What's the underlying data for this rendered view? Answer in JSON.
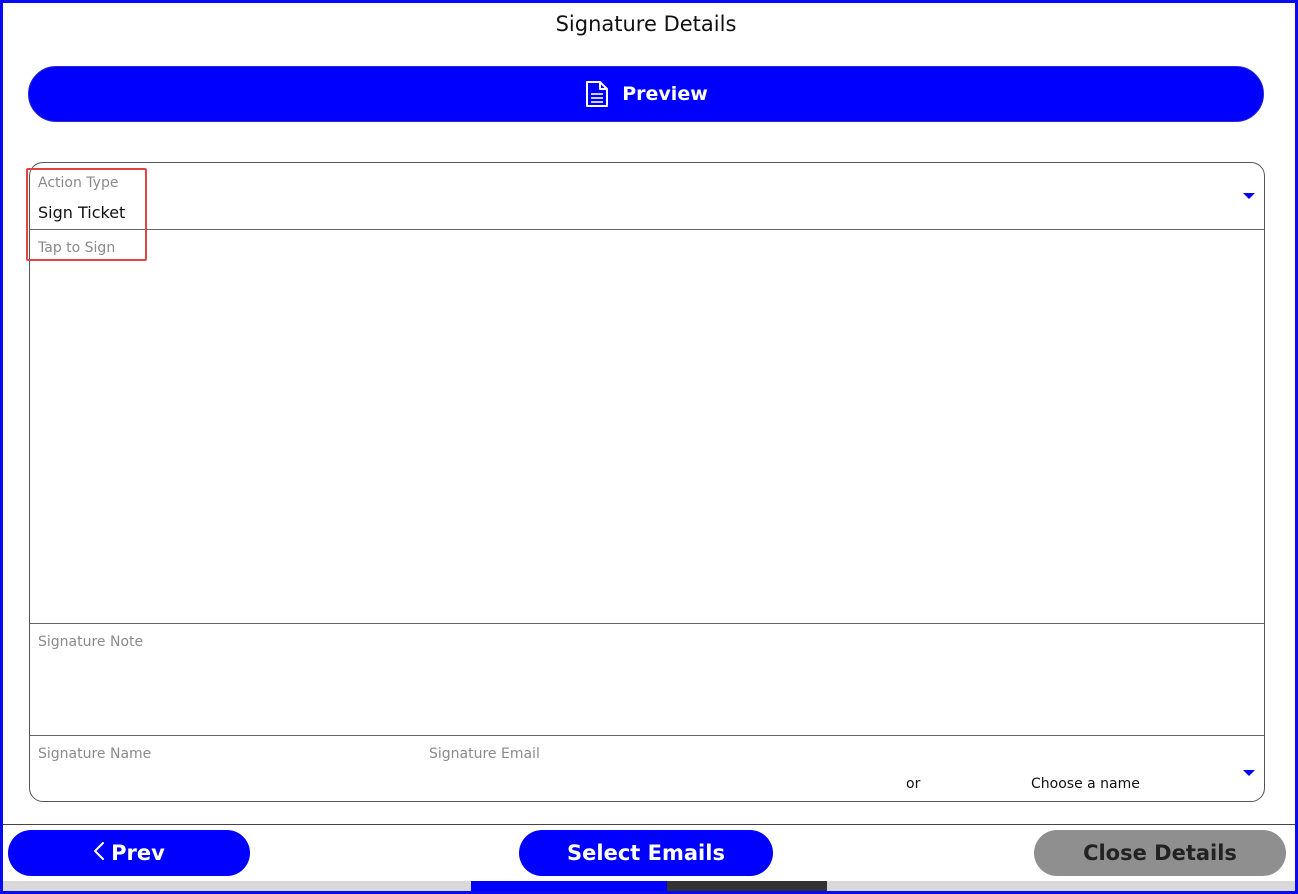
{
  "header": {
    "title": "Signature Details"
  },
  "toolbar": {
    "preview_label": "Preview",
    "preview_icon": "document-icon"
  },
  "form": {
    "action_type": {
      "label": "Action Type",
      "value": "Sign Ticket"
    },
    "signature_pad": {
      "label": "Tap to Sign"
    },
    "signature_note": {
      "label": "Signature Note"
    },
    "signature_name": {
      "label": "Signature Name"
    },
    "signature_email": {
      "label": "Signature Email"
    },
    "or_text": "or",
    "choose_name": {
      "placeholder": "Choose a name"
    }
  },
  "footer": {
    "prev_label": "Prev",
    "select_emails_label": "Select Emails",
    "close_details_label": "Close Details"
  },
  "colors": {
    "accent": "#0000ff",
    "frame_border": "#0a0af0",
    "disabled_button": "#8f8f8f",
    "highlight": "#e04444"
  }
}
